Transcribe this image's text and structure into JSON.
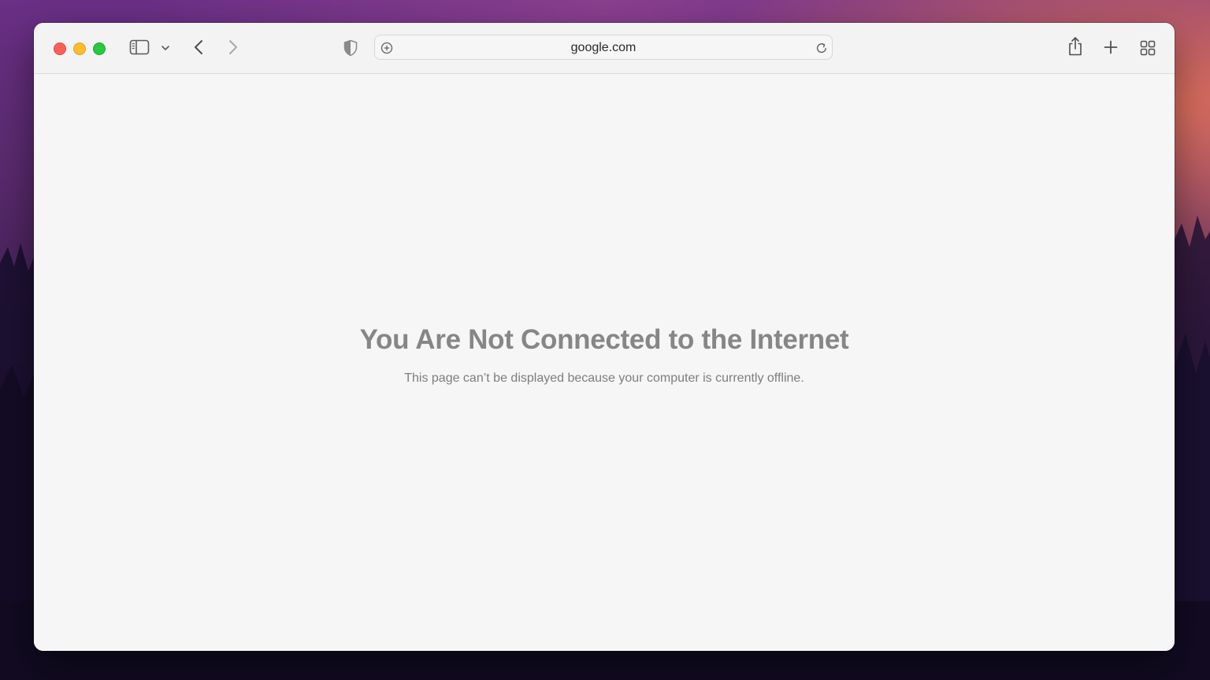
{
  "browser": {
    "url": "google.com"
  },
  "toolbar": {
    "icons": {
      "sidebar": "sidebar-toggle-icon",
      "sidebar_menu": "chevron-down-icon",
      "back": "chevron-left-icon",
      "forward": "chevron-right-icon",
      "privacy": "shield-icon",
      "site_settings": "circle-plus-icon",
      "reload": "reload-icon",
      "share": "share-icon",
      "new_tab": "plus-icon",
      "tab_overview": "grid-icon"
    }
  },
  "window_controls": {
    "close_color": "#fe5f57",
    "minimize_color": "#febc2e",
    "zoom_color": "#28c840"
  },
  "error_page": {
    "title": "You Are Not Connected to the Internet",
    "message": "This page can’t be displayed because your computer is currently offline."
  }
}
